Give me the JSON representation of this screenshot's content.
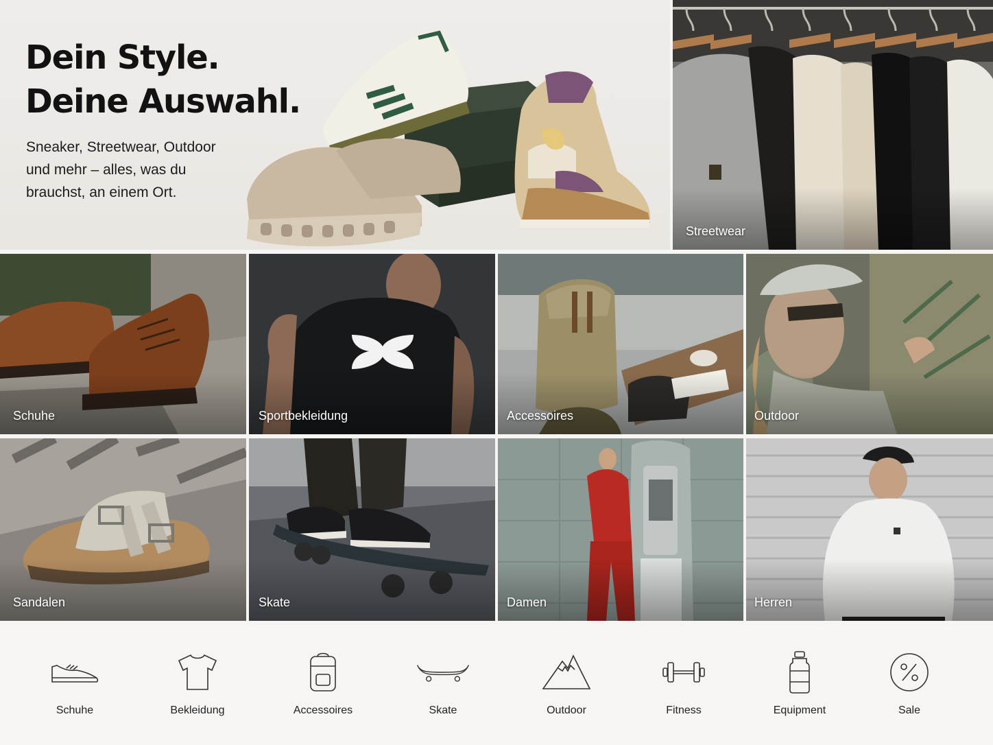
{
  "hero": {
    "title_line1": "Dein Style.",
    "title_line2": "Deine Auswahl.",
    "subtitle": "Sneaker, Streetwear, Outdoor und mehr – alles, was du brauchst, an einem Ort."
  },
  "tiles": {
    "streetwear": "Streetwear",
    "schuhe": "Schuhe",
    "sportbekleidung": "Sportbekleidung",
    "accessoires": "Accessoires",
    "outdoor": "Outdoor",
    "sandalen": "Sandalen",
    "skate": "Skate",
    "damen": "Damen",
    "herren": "Herren"
  },
  "nav": [
    {
      "label": "Schuhe",
      "icon": "shoe-icon"
    },
    {
      "label": "Bekleidung",
      "icon": "tshirt-icon"
    },
    {
      "label": "Accessoires",
      "icon": "backpack-icon"
    },
    {
      "label": "Skate",
      "icon": "skateboard-icon"
    },
    {
      "label": "Outdoor",
      "icon": "mountain-icon"
    },
    {
      "label": "Fitness",
      "icon": "dumbbell-icon"
    },
    {
      "label": "Equipment",
      "icon": "bottle-icon"
    },
    {
      "label": "Sale",
      "icon": "percent-icon"
    }
  ],
  "colors": {
    "page_bg": "#f6f5f3",
    "text": "#111111",
    "tile_label": "#ffffff"
  }
}
